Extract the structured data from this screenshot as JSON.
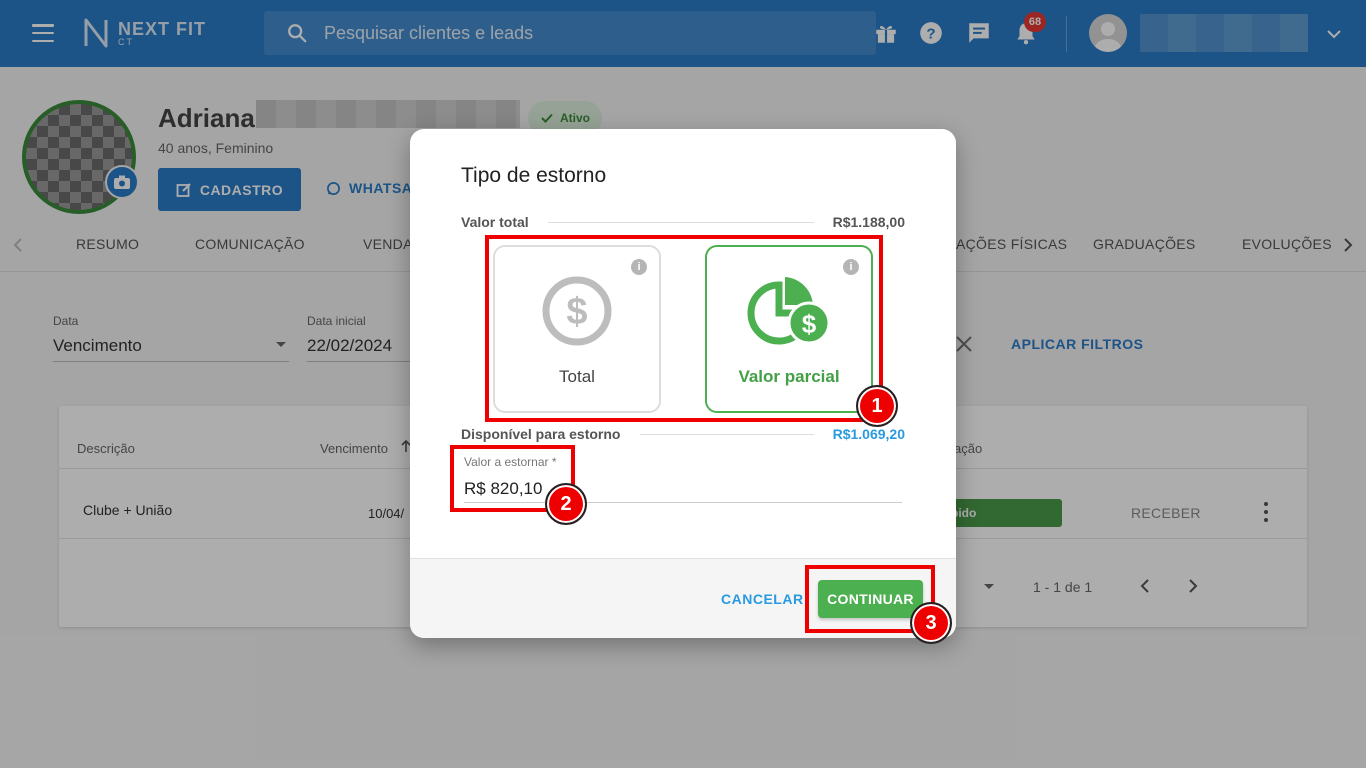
{
  "topbar": {
    "brand": "NEXT FIT",
    "brand_sub": "CT",
    "search_placeholder": "Pesquisar clientes e leads",
    "notifications_count": "68"
  },
  "profile": {
    "first_name": "Adriana",
    "status": "Ativo",
    "subtitle": "40 anos, Feminino",
    "cadastro_label": "CADASTRO",
    "whatsapp_label": "WHATSA"
  },
  "tabs": [
    "RESUMO",
    "COMUNICAÇÃO",
    "VENDA",
    "AÇÕES FÍSICAS",
    "GRADUAÇÕES",
    "EVOLUÇÕES"
  ],
  "filters": {
    "data_label": "Data",
    "data_value": "Vencimento",
    "inicial_label": "Data inicial",
    "inicial_value": "22/02/2024",
    "apply_label": "APLICAR FILTROS"
  },
  "table": {
    "headers": [
      "Descrição",
      "Vencimento",
      "ação"
    ],
    "rows": [
      {
        "descricao": "Clube + União",
        "vencimento": "10/04/",
        "status": "bido",
        "action": "RECEBER"
      }
    ],
    "pagination": "1 - 1 de 1"
  },
  "modal": {
    "title": "Tipo de estorno",
    "valor_total_label": "Valor total",
    "valor_total_value": "R$1.188,00",
    "options": [
      {
        "label": "Total",
        "selected": false
      },
      {
        "label": "Valor parcial",
        "selected": true
      }
    ],
    "disponivel_label": "Disponível para estorno",
    "disponivel_value": "R$1.069,20",
    "amount_label": "Valor a estornar *",
    "amount_value": "R$ 820,10",
    "cancel_label": "CANCELAR",
    "continue_label": "CONTINUAR"
  },
  "annotations": [
    "1",
    "2",
    "3"
  ],
  "colors": {
    "primary": "#2a7cc7",
    "success": "#4caf50",
    "annotation": "#e00000"
  }
}
